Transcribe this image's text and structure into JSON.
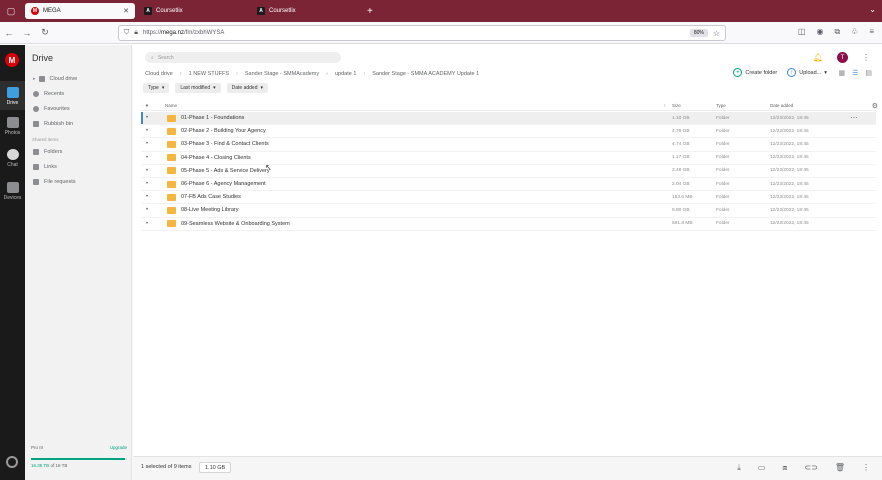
{
  "browser": {
    "tabs": [
      {
        "label": "MEGA",
        "active": true,
        "favicon": "M"
      },
      {
        "label": "Coursetlix",
        "active": false,
        "favicon": "A"
      },
      {
        "label": "Coursetlix",
        "active": false,
        "favicon": "A"
      }
    ],
    "url_prefix": "https://",
    "url_host": "mega.nz",
    "url_path": "/fm/zxbhWYSA",
    "zoom": "80%"
  },
  "rail": {
    "logo": "M",
    "items": [
      {
        "label": "Drive",
        "icon": "folder-icon",
        "active": true
      },
      {
        "label": "Photos",
        "icon": "photos-icon",
        "active": false
      },
      {
        "label": "Chat",
        "icon": "chat-icon",
        "active": false
      },
      {
        "label": "Devices",
        "icon": "devices-icon",
        "active": false
      }
    ]
  },
  "sidebar": {
    "title": "Drive",
    "items": [
      {
        "label": "Cloud drive",
        "icon": "cloud-icon"
      },
      {
        "label": "Recents",
        "icon": "clock-icon"
      },
      {
        "label": "Favourites",
        "icon": "heart-icon"
      },
      {
        "label": "Rubbish bin",
        "icon": "trash-icon"
      }
    ],
    "shared_heading": "Shared items",
    "shared_items": [
      {
        "label": "Folders",
        "icon": "shared-folder-icon"
      },
      {
        "label": "Links",
        "icon": "link-icon"
      },
      {
        "label": "File requests",
        "icon": "file-request-icon"
      }
    ],
    "storage": {
      "plan": "Pro III",
      "upgrade": "Upgrade",
      "used": "16.35 TB",
      "total": "of 16 TB",
      "used_fraction": 0.98
    }
  },
  "main": {
    "search_placeholder": "Search",
    "avatar_initial": "T",
    "breadcrumbs": [
      "Cloud drive",
      "1 NEW STUFFS",
      "Sander Stage - SMMAcademy",
      "update 1",
      "Sander Stage - SMMA ACADEMY Update 1"
    ],
    "create_folder": "Create folder",
    "upload": "Upload...",
    "filters": [
      "Type",
      "Last modified",
      "Date added"
    ],
    "columns": {
      "name": "Name",
      "size": "Size",
      "type": "Type",
      "date": "Date added"
    },
    "rows": [
      {
        "name": "01-Phase 1 - Foundations",
        "size": "1.10 GB",
        "type": "Folder",
        "date": "12/23/2022, 18:45",
        "selected": true
      },
      {
        "name": "02-Phase 2 - Building Your Agency",
        "size": "4.76 GB",
        "type": "Folder",
        "date": "12/23/2022, 18:45",
        "selected": false
      },
      {
        "name": "03-Phase 3 - Find & Contact Clients",
        "size": "4.74 GB",
        "type": "Folder",
        "date": "12/23/2022, 18:45",
        "selected": false
      },
      {
        "name": "04-Phase 4 - Closing Clients",
        "size": "1.17 GB",
        "type": "Folder",
        "date": "12/23/2022, 18:45",
        "selected": false
      },
      {
        "name": "05-Phase 5 - Ads & Service Delivery",
        "size": "2.48 GB",
        "type": "Folder",
        "date": "12/23/2022, 18:45",
        "selected": false
      },
      {
        "name": "06-Phase 6 - Agency Management",
        "size": "2.04 GB",
        "type": "Folder",
        "date": "12/23/2022, 18:45",
        "selected": false
      },
      {
        "name": "07-FB Ads Case Studies",
        "size": "153.6 MB",
        "type": "Folder",
        "date": "12/23/2022, 18:45",
        "selected": false
      },
      {
        "name": "08-Live Meeting Library",
        "size": "5.80 GB",
        "type": "Folder",
        "date": "12/23/2022, 18:45",
        "selected": false
      },
      {
        "name": "09-Seamless Website & Onboarding System",
        "size": "591.8 MB",
        "type": "Folder",
        "date": "12/23/2022, 18:45",
        "selected": false
      }
    ]
  },
  "footer": {
    "selection": "1 selected of 9 items",
    "selection_size": "1.10 GB"
  },
  "colors": {
    "brand": "#d90007",
    "accent": "#00a382",
    "link": "#3f86d6",
    "folder": "#f4b63f",
    "tabbar": "#7a2436"
  }
}
